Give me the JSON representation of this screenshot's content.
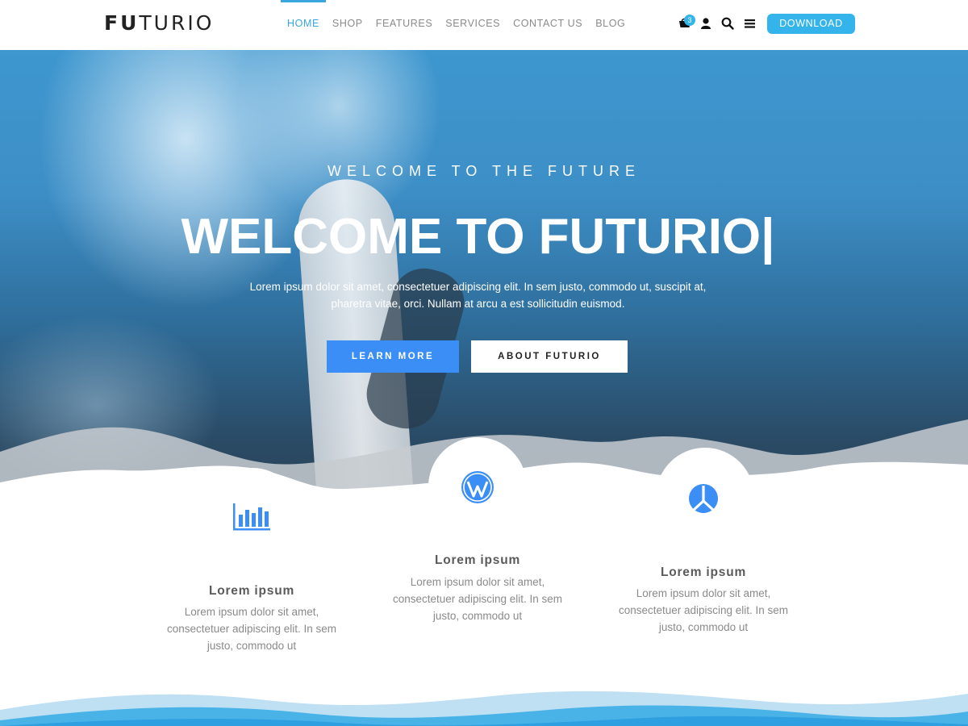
{
  "header": {
    "logo_bold": "FU",
    "logo_light": "TURIO",
    "nav": [
      {
        "label": "HOME",
        "active": true
      },
      {
        "label": "SHOP",
        "active": false
      },
      {
        "label": "FEATURES",
        "active": false
      },
      {
        "label": "SERVICES",
        "active": false
      },
      {
        "label": "CONTACT US",
        "active": false
      },
      {
        "label": "BLOG",
        "active": false
      }
    ],
    "cart_count": "3",
    "icons": [
      "cart-icon",
      "user-icon",
      "search-icon",
      "menu-icon"
    ],
    "download_label": "DOWNLOAD"
  },
  "hero": {
    "kicker": "WELCOME TO THE FUTURE",
    "title": "WELCOME TO FUTURIO|",
    "text": "Lorem ipsum dolor sit amet, consectetuer adipiscing elit. In sem justo, commodo ut, suscipit at, pharetra vitae, orci. Nullam at arcu a est sollicitudin euismod.",
    "primary_button": "LEARN MORE",
    "secondary_button": "ABOUT FUTURIO"
  },
  "features": [
    {
      "icon": "bar-chart-icon",
      "title": "Lorem ipsum",
      "text": "Lorem ipsum dolor sit amet, consectetuer adipiscing elit. In sem justo, commodo ut"
    },
    {
      "icon": "wordpress-icon",
      "title": "Lorem ipsum",
      "text": "Lorem ipsum dolor sit amet, consectetuer adipiscing elit. In sem justo, commodo ut"
    },
    {
      "icon": "aperture-icon",
      "title": "Lorem ipsum",
      "text": "Lorem ipsum dolor sit amet, consectetuer adipiscing elit. In sem justo, commodo ut"
    }
  ],
  "colors": {
    "accent": "#35b4ec",
    "nav_active": "#3aa6dd",
    "button_primary": "#3b8ef5",
    "icon_blue": "#3b8ef5",
    "heading": "#5a5a5a",
    "body_text": "#8a8a8a"
  }
}
